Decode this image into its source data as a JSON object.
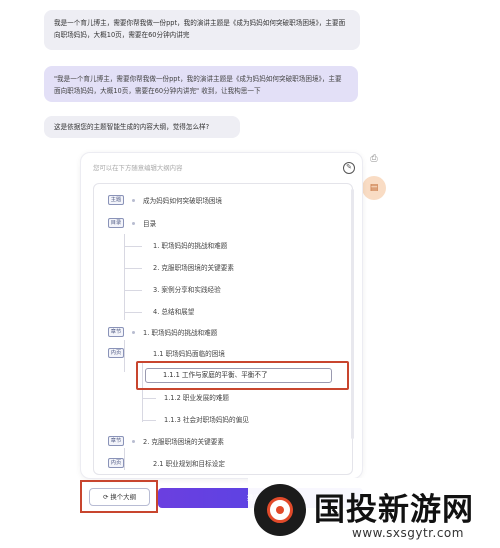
{
  "chat": {
    "msg1": "我是一个育儿博主，需要你帮我做一份ppt，我的演讲主题是《成为妈妈如何突破职场困境》，主要面向职场妈妈，大概10页，需要在60分钟内讲完",
    "msg2": "\"我是一个育儿博主，需要你帮我做一份ppt，我的演讲主题是《成为妈妈如何突破职场困境》，主要面向职场妈妈，大概10页，需要在60分钟内讲完\" 收到，让我构思一下",
    "msg3": "这是依据您的主题智能生成的内容大纲，觉得怎么样?"
  },
  "panel": {
    "hint": "您可以在下方随意编辑大纲内容",
    "edit_icon": "edit-icon"
  },
  "outline": {
    "tags": {
      "theme": "主题",
      "toc": "目录",
      "chapter": "章节",
      "content": "内页"
    },
    "theme_title": "成为妈妈如何突破职场困境",
    "toc_title": "目录",
    "toc_items": [
      "1. 职场妈妈的挑战和难题",
      "2. 克服职场困境的关键要素",
      "3. 案例分享和实践经验",
      "4. 总结和展望"
    ],
    "chapter1": "1. 职场妈妈的挑战和难题",
    "ch1_sub": "1.1 职场妈妈面临的困境",
    "ch1_sub_items": [
      "1.1.1 工作与家庭的平衡、平衡不了",
      "1.1.2 职业发展的难题",
      "1.1.3 社会对职场妈妈的偏见"
    ],
    "chapter2": "2. 克服职场困境的关键要素",
    "ch2_sub": "2.1 职业规划和目标设定"
  },
  "buttons": {
    "change_outline": "换个大纲",
    "select": "挑选 PPT"
  },
  "side_icons": [
    "print-icon",
    "document-icon"
  ],
  "watermark": {
    "title": "国投新游网",
    "url": "www.sxsgytr.com"
  },
  "colors": {
    "accent": "#5b3fe0",
    "highlight": "#c8452e",
    "user_bubble": "#eeeef4",
    "assistant_bubble": "#e3e0f7"
  }
}
